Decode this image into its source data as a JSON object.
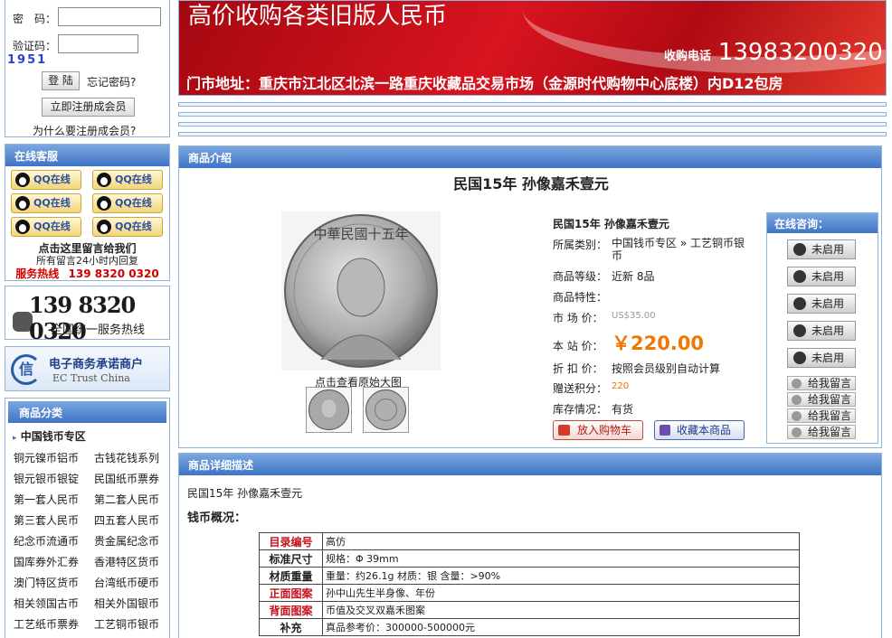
{
  "login": {
    "password_label": "密　码：",
    "captcha_label": "验证码：",
    "captcha_code": "1951",
    "login_button": "登 陆",
    "forgot": "忘记密码?",
    "register_button": "立即注册成会员",
    "why_register": "为什么要注册成会员?"
  },
  "service": {
    "title": "在线客服",
    "qq_label": "QQ在线",
    "leave_msg": "点击这里留言给我们",
    "reply_note": "所有留言24小时内回复",
    "hotline_label": "服务热线",
    "hotline_number": "139 8320 0320"
  },
  "hotline_box": {
    "number": "139 8320 0320",
    "subtitle": "全国统一服务热线"
  },
  "trust": {
    "line1": "电子商务承诺商户",
    "line2": "EC Trust China",
    "logo_char": "信"
  },
  "categories": {
    "title": "商品分类",
    "main": "中国钱币专区",
    "items": [
      "铜元镍币铝币",
      "古钱花钱系列",
      "银元银币银锭",
      "民国纸币票券",
      "第一套人民币",
      "第二套人民币",
      "第三套人民币",
      "四五套人民币",
      "纪念币流通币",
      "贵金属纪念币",
      "国库券外汇券",
      "香港特区货币",
      "澳门特区货币",
      "台湾纸币硬币",
      "相关领国古币",
      "相关外国银币",
      "工艺纸币票券",
      "工艺铜币银币"
    ]
  },
  "banner": {
    "headline": "高价收购各类旧版人民币",
    "phone_label": "收购电话",
    "phone": "13983200320",
    "address": "门市地址：重庆市江北区北滨一路重庆收藏品交易市场（金源时代购物中心底楼）内D12包房"
  },
  "product": {
    "section_title": "商品介绍",
    "title": "民国15年  孙像嘉禾壹元",
    "name": "民国15年  孙像嘉禾壹元",
    "coin_inscription": "中華民國十五年",
    "view_large": "点击查看原始大图",
    "category_label": "所属类别：",
    "category_value": "中国钱币专区 » 工艺铜币银币",
    "grade_label": "商品等级：",
    "grade_value": "近新 8品",
    "property_label": "商品特性：",
    "market_label": "市 场 价：",
    "market_value": "US$35.00",
    "price_label": "本 站 价：",
    "price_value": "￥220.00",
    "discount_label": "折 扣 价：",
    "discount_value": "按照会员级别自动计算",
    "points_label": "赠送积分：",
    "points_value": "220",
    "stock_label": "库存情况：",
    "stock_value": "有货",
    "cart_button": "放入购物车",
    "fav_button": "收藏本商品"
  },
  "consult": {
    "title": "在线咨询：",
    "disabled_label": "未启用",
    "message_label": "给我留言"
  },
  "detail": {
    "section_title": "商品详细描述",
    "intro": "民国15年 孙像嘉禾壹元",
    "overview": "钱币概况：",
    "rows": [
      {
        "key": "目录编号",
        "value": "高仿",
        "red": true
      },
      {
        "key": "标准尺寸",
        "value": "规格：Φ 39mm",
        "red": false
      },
      {
        "key": "材质重量",
        "value": "重量：约26.1g 材质：银 含量：>90%",
        "red": false
      },
      {
        "key": "正面图案",
        "value": "孙中山先生半身像、年份",
        "red": true
      },
      {
        "key": "背面图案",
        "value": "币值及交叉双嘉禾图案",
        "red": true
      },
      {
        "key": "补充",
        "value": "真品参考价：300000-500000元",
        "red": false
      }
    ]
  },
  "colors": {
    "accent_blue": "#3f74c6",
    "banner_red": "#c4101a",
    "price_orange": "#f07800",
    "hotline_red": "#d40000"
  }
}
